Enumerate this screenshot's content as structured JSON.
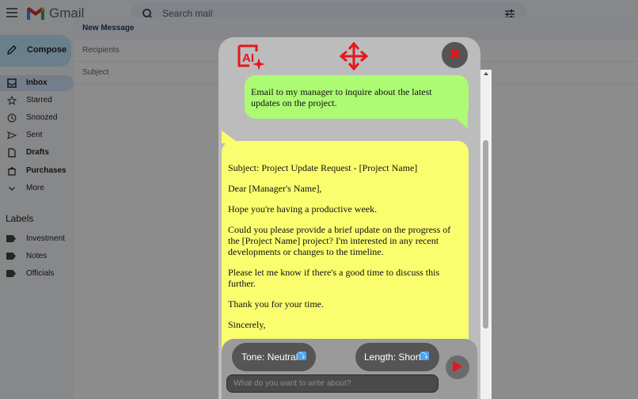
{
  "gmail": {
    "logo_text": "Gmail",
    "search_placeholder": "Search mail",
    "compose_label": "Compose",
    "nav": [
      {
        "label": "Inbox",
        "icon": "inbox-icon"
      },
      {
        "label": "Starred",
        "icon": "star-icon"
      },
      {
        "label": "Snoozed",
        "icon": "clock-icon"
      },
      {
        "label": "Sent",
        "icon": "send-icon"
      },
      {
        "label": "Drafts",
        "icon": "draft-icon"
      },
      {
        "label": "Purchases",
        "icon": "tag-icon"
      },
      {
        "label": "More",
        "icon": "chevron-down-icon"
      }
    ],
    "labels_title": "Labels",
    "labels": [
      "Investment",
      "Notes",
      "Officials"
    ],
    "compose_window": {
      "title": "New Message",
      "recipients_placeholder": "Recipients",
      "subject_placeholder": "Subject"
    }
  },
  "assistant": {
    "user_message": "Email to my manager to inquire about the latest updates on the project.",
    "reply_paragraphs": [
      "Subject: Project Update Request - [Project Name]",
      "Dear [Manager's Name],",
      "Hope you're having a productive week.",
      "Could you please provide a brief update on the progress of the [Project Name] project? I'm interested in any recent developments or changes to the timeline.",
      "Please let me know if there's a good time to discuss this further.",
      "Thank you for your time.",
      "Sincerely,"
    ],
    "tone_label": "Tone: Neutral",
    "length_label": "Length: Short",
    "input_placeholder": "What do you want to write about?",
    "accent_color": "#e8151b",
    "user_bubble_color": "#acfb73",
    "ai_bubble_color": "#f9fd6e"
  }
}
